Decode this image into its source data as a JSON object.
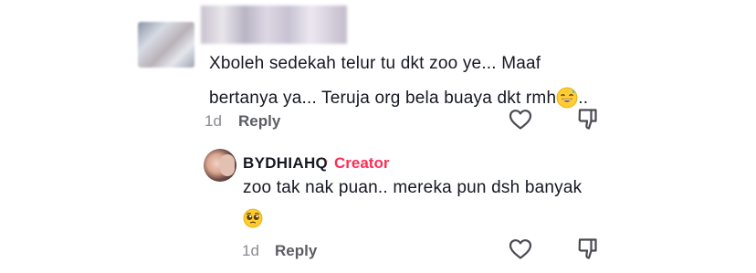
{
  "comment": {
    "line1": "Xboleh sedekah telur tu dkt zoo ye... Maaf",
    "line2_text": "bertanya ya... Teruja org bela buaya dkt rmh",
    "line2_suffix": "..",
    "emoji_icon": "sweat-smile-emoji-icon",
    "time": "1d",
    "reply_label": "Reply"
  },
  "reply": {
    "author": "BYDHIAHQ",
    "separator": "·",
    "creator_label": "Creator",
    "text": "zoo tak nak puan.. mereka pun dsh banyak",
    "emoji_icon": "pleading-face-emoji-icon",
    "time": "1d",
    "reply_label": "Reply"
  },
  "icons": {
    "like": "heart-outline-icon",
    "dislike": "thumbs-down-outline-icon"
  },
  "colors": {
    "text": "#161823",
    "muted": "#8a8b91",
    "creator": "#fe2c55"
  }
}
